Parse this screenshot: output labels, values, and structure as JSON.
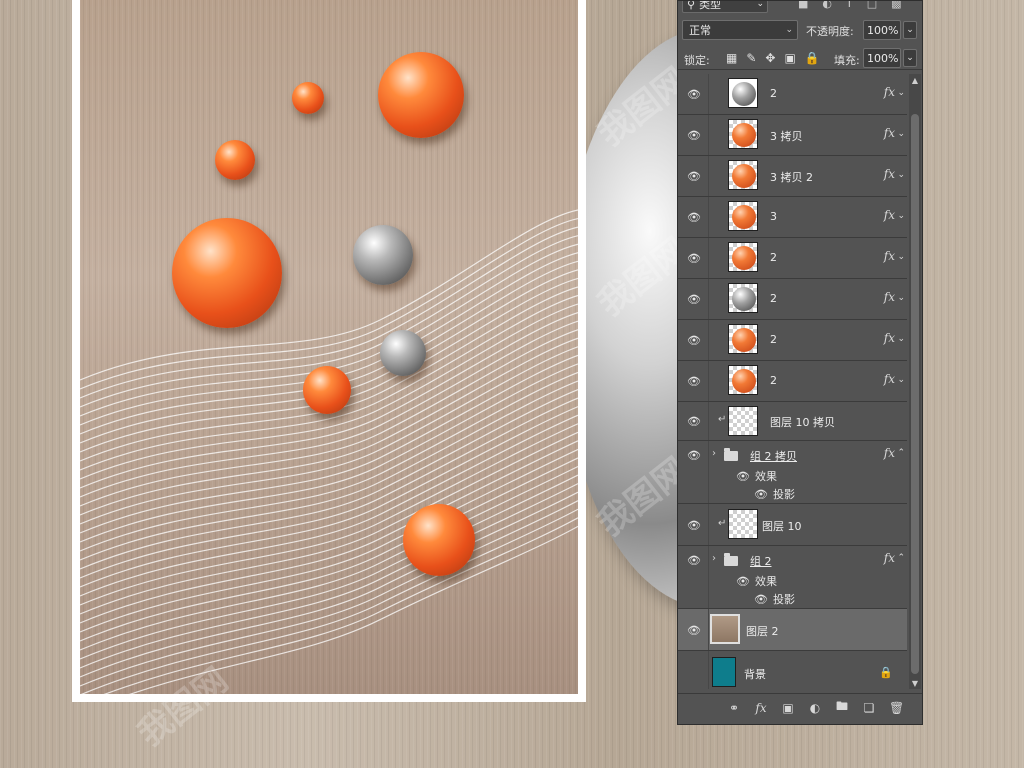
{
  "canvas": {
    "watermark_text": "我图网"
  },
  "layers_panel": {
    "filter": {
      "label": "类型",
      "icon": "search-icon"
    },
    "blend_mode": {
      "value": "正常"
    },
    "opacity": {
      "label": "不透明度:",
      "value": "100%"
    },
    "lock": {
      "label": "锁定:"
    },
    "fill": {
      "label": "填充:",
      "value": "100%"
    },
    "layers": [
      {
        "name": "2",
        "thumb": "gray",
        "fx": "fx"
      },
      {
        "name": "3 拷贝",
        "thumb": "orange",
        "fx": "fx"
      },
      {
        "name": "3 拷贝 2",
        "thumb": "orange",
        "fx": "fx"
      },
      {
        "name": "3",
        "thumb": "orange",
        "fx": "fx"
      },
      {
        "name": "2",
        "thumb": "orange",
        "fx": "fx"
      },
      {
        "name": "2",
        "thumb": "gray",
        "fx": "fx"
      },
      {
        "name": "2",
        "thumb": "orange",
        "fx": "fx"
      },
      {
        "name": "2",
        "thumb": "orange",
        "fx": "fx"
      },
      {
        "name": "图层 10 拷贝",
        "thumb": "checker",
        "clipped": true
      },
      {
        "name": "组 2 拷贝",
        "type": "group",
        "fx": "fx",
        "effects_label": "效果",
        "effect_item": "投影"
      },
      {
        "name": "图层 10",
        "thumb": "checker",
        "clipped": true
      },
      {
        "name": "组 2",
        "type": "group",
        "fx": "fx",
        "effects_label": "效果",
        "effect_item": "投影"
      },
      {
        "name": "图层 2",
        "thumb": "photo",
        "selected": true
      },
      {
        "name": "背景",
        "thumb": "teal",
        "locked": true
      }
    ],
    "footer_buttons": [
      "link-layers",
      "add-style",
      "add-mask",
      "adjustment-layer",
      "new-group",
      "new-layer",
      "delete-layer"
    ]
  }
}
